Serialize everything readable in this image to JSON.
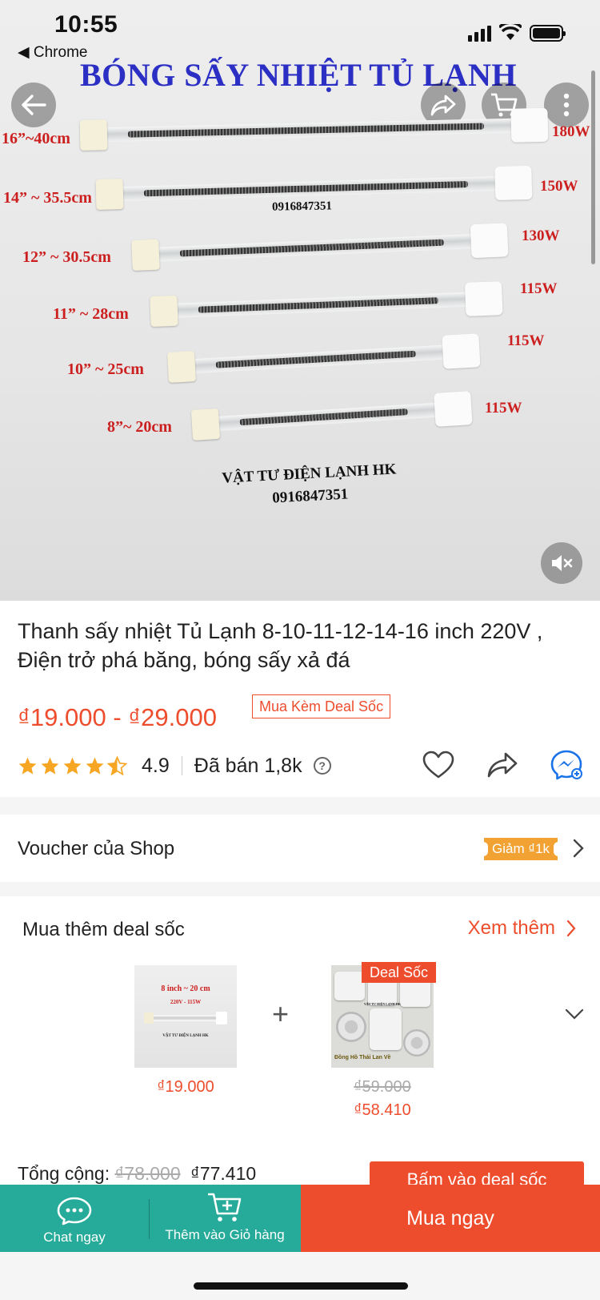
{
  "status_bar": {
    "time": "10:55",
    "back_label": "◀ Chrome"
  },
  "hero": {
    "title": "BÓNG SẤY NHIỆT TỦ LẠNH",
    "phone_mid": "0916847351",
    "shop_name": "VẬT TƯ ĐIỆN LẠNH HK",
    "shop_phone": "0916847351",
    "sizes": [
      "16”~40cm",
      "14” ~ 35.5cm",
      "12” ~ 30.5cm",
      "11” ~ 28cm",
      "10” ~ 25cm",
      "8”~ 20cm"
    ],
    "watts": [
      "180W",
      "150W",
      "130W",
      "115W",
      "115W",
      "115W"
    ],
    "icons": [
      "back-arrow-icon",
      "share-icon",
      "cart-icon",
      "more-icon",
      "mute-icon"
    ]
  },
  "product": {
    "title": "Thanh sấy nhiệt Tủ Lạnh 8-10-11-12-14-16 inch 220V , Điện trở phá băng, bóng sấy xả đá",
    "price_range": "₫19.000 - ₫29.000",
    "deal_tag": "Mua Kèm Deal Sốc",
    "rating": "4.9",
    "rating_stars": 4.5,
    "sold": "Đã bán 1,8k",
    "help_symbol": "?"
  },
  "voucher": {
    "label": "Voucher của Shop",
    "badge": "Giảm ₫1k"
  },
  "deal_section": {
    "heading": "Mua thêm deal sốc",
    "see_more": "Xem thêm",
    "plus": "+",
    "items": [
      {
        "thumb_title": "8 inch ~ 20 cm",
        "thumb_sub": "220V - 115W",
        "thumb_small": "VẬT TƯ ĐIỆN LẠNH HK",
        "price": "₫19.000"
      },
      {
        "ribbon": "Deal Sốc",
        "thumb_title": "VẬT TƯ ĐIỆN LẠNH HK",
        "thumb_caption": "Đồng Hồ Thái Lan Về",
        "old_price": "₫59.000",
        "price": "₫58.410"
      }
    ],
    "total_label": "Tổng cộng:",
    "total_old": "₫78.000",
    "total_new": "₫77.410",
    "buy_button": "Bấm vào deal sốc"
  },
  "bottom_bar": {
    "chat_label": "Chat ngay",
    "cart_label": "Thêm vào Giỏ hàng",
    "buy_label": "Mua ngay"
  },
  "colors": {
    "accent": "#ee4d2d",
    "teal": "#26aa99",
    "voucher": "#f2a233",
    "star": "#f6a623",
    "hero_title": "#2c2fc4"
  }
}
